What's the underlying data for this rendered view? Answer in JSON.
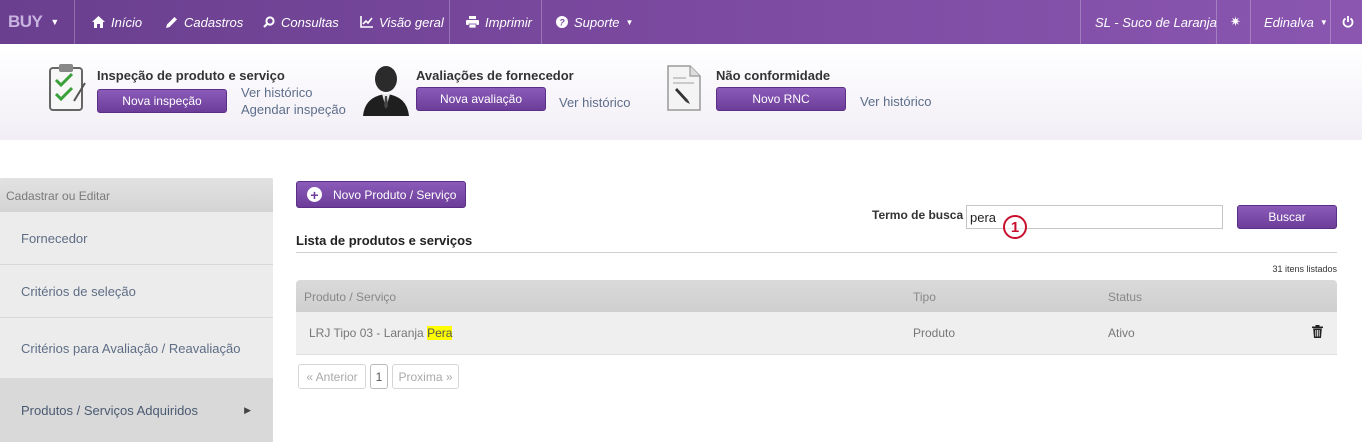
{
  "navbar": {
    "brand": "BUY",
    "items": [
      {
        "label": "Início",
        "icon": "home-icon"
      },
      {
        "label": "Cadastros",
        "icon": "pencil-icon"
      },
      {
        "label": "Consultas",
        "icon": "search-icon"
      },
      {
        "label": "Visão geral",
        "icon": "chart-icon"
      },
      {
        "label": "Imprimir",
        "icon": "printer-icon"
      },
      {
        "label": "Suporte",
        "icon": "help-icon"
      }
    ],
    "company": "SL - Suco de Laranja",
    "user": "Edinalva",
    "accent_color": "#7b4aa0"
  },
  "quick_actions": {
    "inspection": {
      "title": "Inspeção de produto e serviço",
      "button": "Nova inspeção",
      "link_history": "Ver histórico",
      "link_schedule": "Agendar inspeção"
    },
    "evaluation": {
      "title": "Avaliações de fornecedor",
      "button": "Nova avaliação",
      "link_history": "Ver histórico"
    },
    "nonconformity": {
      "title": "Não conformidade",
      "button": "Novo RNC",
      "link_history": "Ver histórico"
    }
  },
  "sidebar": {
    "header": "Cadastrar ou Editar",
    "items": [
      {
        "label": "Fornecedor"
      },
      {
        "label": "Critérios de seleção"
      },
      {
        "label": "Critérios para Avaliação / Reavaliação"
      },
      {
        "label": "Produtos / Serviços Adquiridos"
      }
    ]
  },
  "main": {
    "new_button": "Novo Produto / Serviço",
    "search_label": "Termo de busca",
    "search_value": "pera",
    "search_button": "Buscar",
    "callout_marker": "1",
    "list_title": "Lista de produtos e serviços",
    "count_text": "31 itens listados",
    "table": {
      "columns": [
        "Produto / Serviço",
        "Tipo",
        "Status"
      ],
      "rows": [
        {
          "name_prefix": "LRJ Tipo 03 - Laranja ",
          "name_highlight": "Pera",
          "type": "Produto",
          "status": "Ativo"
        }
      ]
    },
    "pagination": {
      "prev": "« Anterior",
      "current": "1",
      "next": "Proxima »"
    }
  }
}
